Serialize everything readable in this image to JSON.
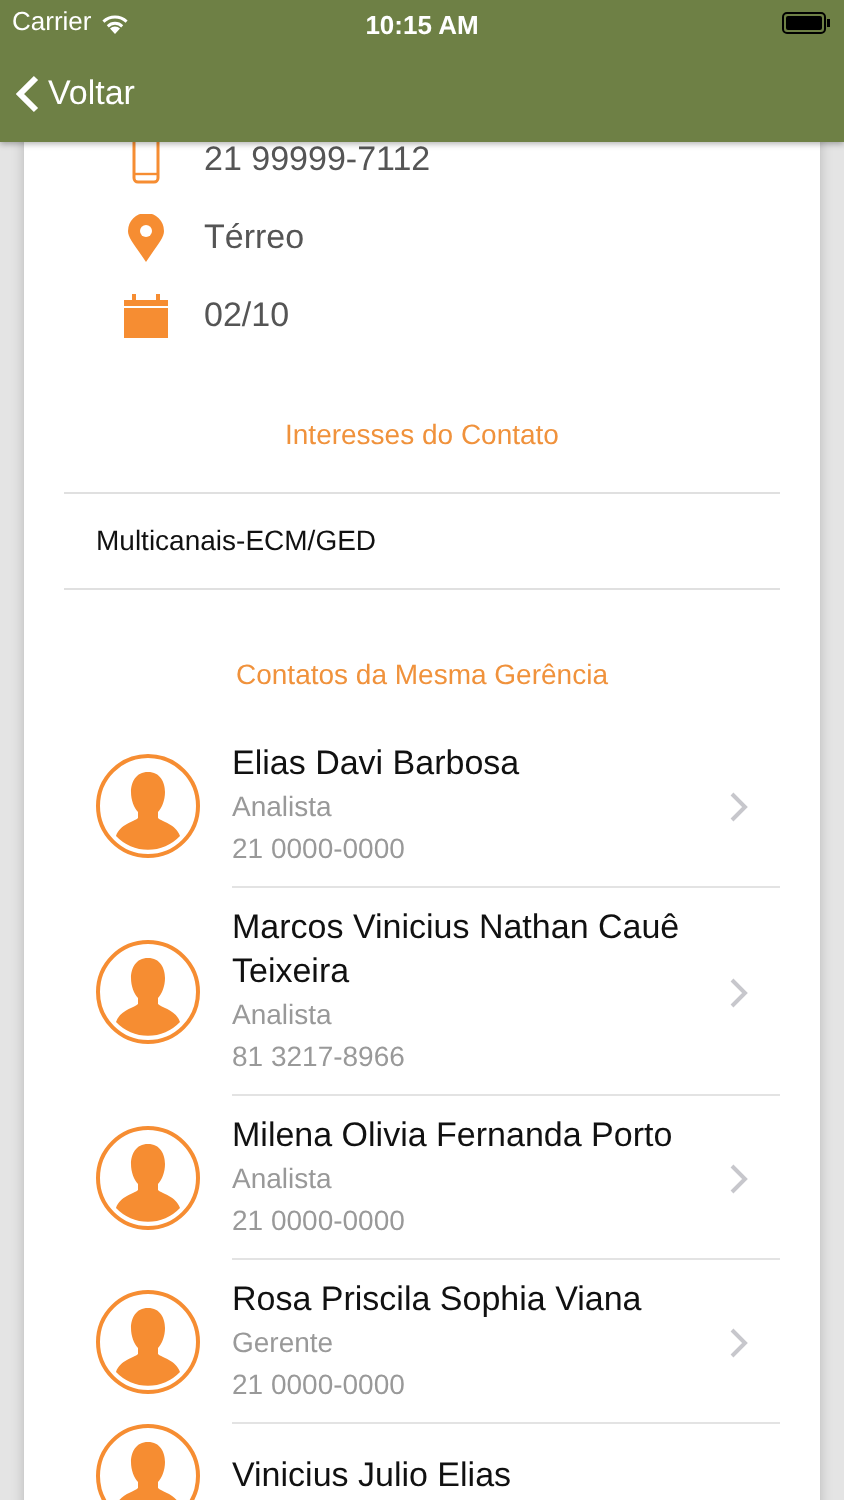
{
  "status_bar": {
    "carrier": "Carrier",
    "time": "10:15 AM"
  },
  "nav": {
    "back": "Voltar"
  },
  "details": [
    {
      "kind": "phone",
      "text": "21 99999-7112"
    },
    {
      "kind": "location",
      "text": "Térreo"
    },
    {
      "kind": "date",
      "text": "02/10"
    }
  ],
  "interests": {
    "title": "Interesses do Contato",
    "items": [
      "Multicanais-ECM/GED"
    ]
  },
  "contacts": {
    "title": "Contatos da Mesma Gerência",
    "items": [
      {
        "name": "Elias Davi Barbosa",
        "role": "Analista",
        "phone": "21 0000-0000"
      },
      {
        "name": "Marcos Vinicius Nathan Cauê Teixeira",
        "role": "Analista",
        "phone": "81 3217-8966"
      },
      {
        "name": "Milena Olivia Fernanda Porto",
        "role": "Analista",
        "phone": "21 0000-0000"
      },
      {
        "name": "Rosa Priscila Sophia Viana",
        "role": "Gerente",
        "phone": "21 0000-0000"
      },
      {
        "name": "Vinicius Julio Elias"
      }
    ]
  }
}
